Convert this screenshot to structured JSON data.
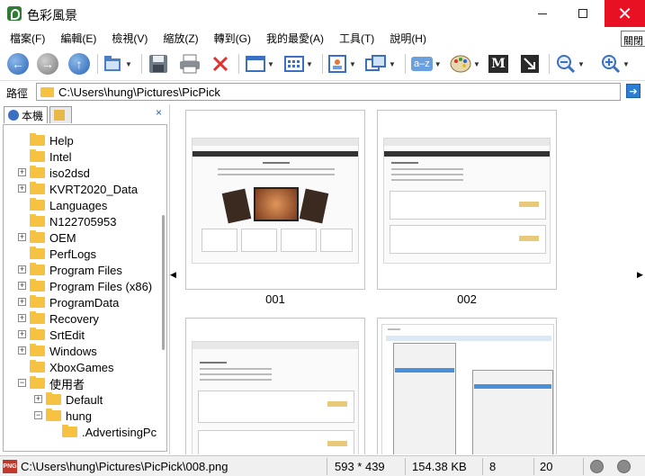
{
  "window": {
    "title": "色彩風景",
    "tooltip": "關閉",
    "minimize_glyph": "—",
    "close_glyph": "✕"
  },
  "menu": [
    "檔案(F)",
    "編輯(E)",
    "檢視(V)",
    "縮放(Z)",
    "轉到(G)",
    "我的最愛(A)",
    "工具(T)",
    "說明(H)"
  ],
  "toolbar": {
    "back_glyph": "←",
    "forward_glyph": "→",
    "up_glyph": "↑",
    "sort_label": "a–z",
    "m_label": "M"
  },
  "path": {
    "label": "路徑",
    "value": "C:\\Users\\hung\\Pictures\\PicPick"
  },
  "left_pane": {
    "tabs": [
      "本機",
      ""
    ],
    "close_glyph": "×"
  },
  "tree": [
    {
      "label": "Help",
      "expander": ""
    },
    {
      "label": "Intel",
      "expander": ""
    },
    {
      "label": "iso2dsd",
      "expander": "+"
    },
    {
      "label": "KVRT2020_Data",
      "expander": "+"
    },
    {
      "label": "Languages",
      "expander": ""
    },
    {
      "label": "N122705953",
      "expander": ""
    },
    {
      "label": "OEM",
      "expander": "+"
    },
    {
      "label": "PerfLogs",
      "expander": ""
    },
    {
      "label": "Program Files",
      "expander": "+"
    },
    {
      "label": "Program Files (x86)",
      "expander": "+"
    },
    {
      "label": "ProgramData",
      "expander": "+"
    },
    {
      "label": "Recovery",
      "expander": "+"
    },
    {
      "label": "SrtEdit",
      "expander": "+"
    },
    {
      "label": "Windows",
      "expander": "+"
    },
    {
      "label": "XboxGames",
      "expander": ""
    },
    {
      "label": "使用者",
      "expander": "−"
    },
    {
      "label": "Default",
      "expander": "+"
    },
    {
      "label": "hung",
      "expander": "−"
    },
    {
      "label": ".AdvertisingPc",
      "expander": ""
    }
  ],
  "thumbnails": [
    {
      "label": "001"
    },
    {
      "label": "002"
    },
    {
      "label": ""
    },
    {
      "label": ""
    }
  ],
  "status": {
    "path": "C:\\Users\\hung\\Pictures\\PicPick\\008.png",
    "dimensions": "593 * 439",
    "size": "154.38 KB",
    "index": "8",
    "count": "20"
  }
}
